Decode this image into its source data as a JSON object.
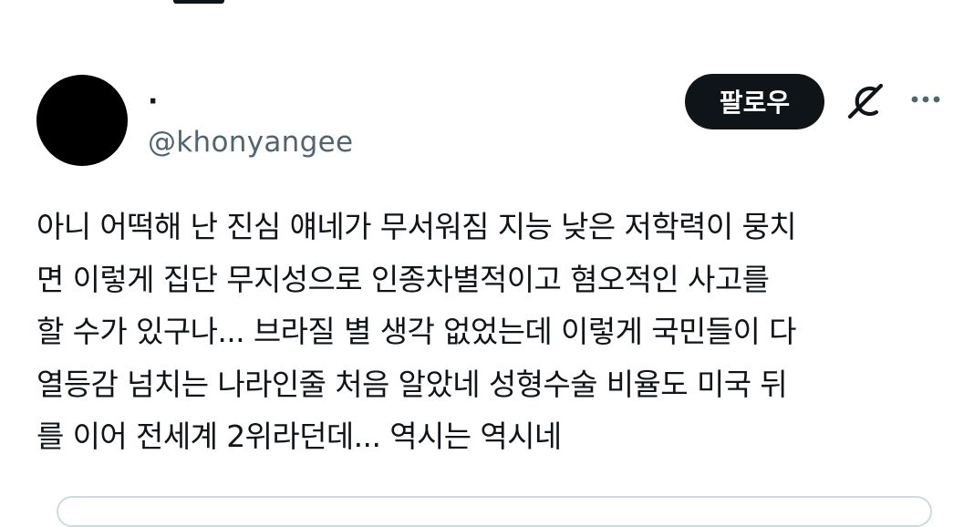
{
  "tweet": {
    "author": {
      "display_name": "·",
      "handle": "@khonyangee"
    },
    "follow_label": "팔로우",
    "text": "아니 어떡해 난 진심 얘네가 무서워짐 지능 낮은 저학력이 뭉치\n면 이렇게 집단 무지성으로 인종차별적이고 혐오적인 사고를\n할 수가 있구나... 브라질 별 생각 없었는데 이렇게 국민들이 다\n열등감 넘치는 나라인줄 처음 알았네 성형수술 비율도 미국 뒤\n를 이어 전세계 2위라던데...  역시는 역시네",
    "icons": {
      "grok": "grok-icon",
      "more": "more-options-icon"
    }
  },
  "colors": {
    "text_primary": "#0f1419",
    "text_secondary": "#536471",
    "follow_bg": "#0f1419",
    "follow_text": "#ffffff",
    "border": "#cfd9de"
  }
}
